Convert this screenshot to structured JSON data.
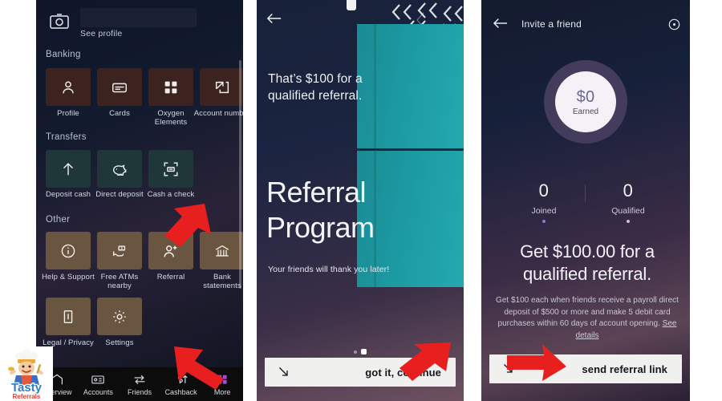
{
  "panel1": {
    "profile": {
      "see_profile": "See profile",
      "camera_icon": "camera-icon"
    },
    "sections": [
      {
        "label": "Banking"
      },
      {
        "label": "Transfers"
      },
      {
        "label": "Other"
      }
    ],
    "banking_tiles": [
      {
        "label": "Profile",
        "icon": "person-icon"
      },
      {
        "label": "Cards",
        "icon": "card-icon"
      },
      {
        "label": "Oxygen Elements",
        "icon": "grid-icon"
      },
      {
        "label": "Account number",
        "icon": "share-out-icon"
      }
    ],
    "transfer_tiles": [
      {
        "label": "Deposit cash",
        "icon": "up-arrow-icon"
      },
      {
        "label": "Direct deposit",
        "icon": "piggy-bank-icon"
      },
      {
        "label": "Cash a check",
        "icon": "scan-check-icon"
      }
    ],
    "other_tiles": [
      {
        "label": "Help & Support",
        "icon": "info-circle-icon"
      },
      {
        "label": "Free ATMs nearby",
        "icon": "hand-cash-icon"
      },
      {
        "label": "Referral",
        "icon": "person-plus-icon"
      },
      {
        "label": "Bank statements",
        "icon": "bank-icon"
      },
      {
        "label": "Legal / Privacy",
        "icon": "document-icon"
      },
      {
        "label": "Settings",
        "icon": "gear-icon"
      }
    ],
    "tabs": [
      {
        "label": "Overview",
        "icon": "home-icon",
        "active": false
      },
      {
        "label": "Accounts",
        "icon": "id-card-icon",
        "active": false
      },
      {
        "label": "Friends",
        "icon": "swap-arrows-icon",
        "active": false
      },
      {
        "label": "Cashback",
        "icon": "dollar-arrow-icon",
        "active": false
      },
      {
        "label": "More",
        "icon": "grid-squares-icon",
        "active": true
      }
    ],
    "colors": {
      "banking_tile": "#3c231f",
      "transfer_tile": "#203739",
      "other_tile": "#6a5540",
      "tab_active": "#9b5fc9"
    }
  },
  "panel2": {
    "back_icon": "back-arrow-icon",
    "kicker": "That’s $100 for a qualified referral.",
    "headline_line1": "Referral",
    "headline_line2": "Program",
    "subtext": "Your friends will thank you later!",
    "cta_label": "got it, continue",
    "cta_icon": "corner-arrow-icon",
    "pager": {
      "total": 2,
      "active_index": 1
    }
  },
  "panel3": {
    "back_icon": "back-arrow-icon",
    "title": "Invite a friend",
    "info_icon": "info-circle-icon",
    "earned_amount": "$0",
    "earned_label": "Earned",
    "stats": [
      {
        "value": "0",
        "label": "Joined",
        "dot_color": "#8b7ad1"
      },
      {
        "value": "0",
        "label": "Qualified",
        "dot_color": "#c9c6d4"
      }
    ],
    "headline": "Get $100.00 for a qualified referral.",
    "body": "Get $100 each when friends receive a payroll direct deposit of $500 or more and make 5 debit card purchases within 60 days of account opening.",
    "body_link": "See details",
    "cta_label": "send referral link",
    "cta_icon": "corner-arrow-icon"
  },
  "watermark": {
    "name_top": "Tasty",
    "name_bottom": "Referrals"
  },
  "annotations": {
    "arrows": [
      {
        "name": "arrow-to-referral-tile",
        "color": "#e81f1f"
      },
      {
        "name": "arrow-to-more-tab",
        "color": "#e81f1f"
      },
      {
        "name": "arrow-to-got-it-continue",
        "color": "#e81f1f"
      },
      {
        "name": "arrow-to-send-referral-link",
        "color": "#e81f1f"
      }
    ]
  }
}
